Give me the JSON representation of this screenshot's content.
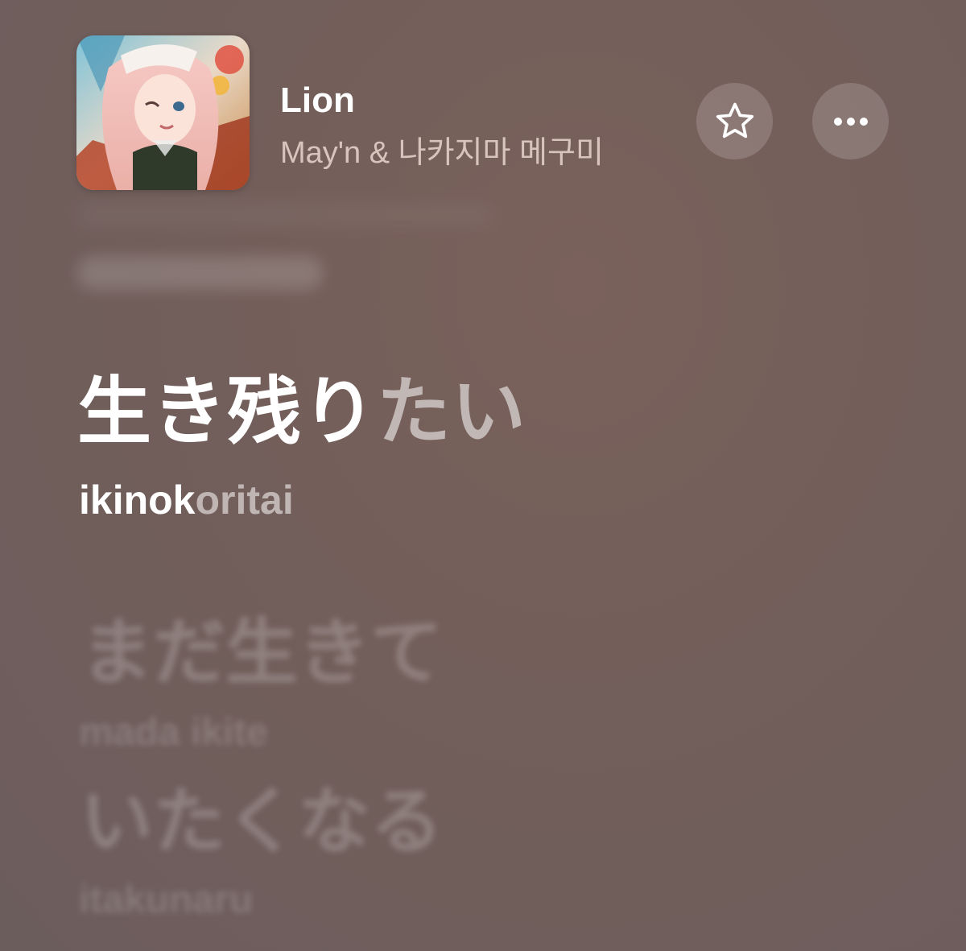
{
  "now_playing": {
    "title": "Lion",
    "artist": "May'n & 나카지마 메구미",
    "artwork_icon": "album-artwork"
  },
  "actions": {
    "favorite_icon": "star-outline-icon",
    "more_icon": "ellipsis-icon"
  },
  "lyrics": {
    "current": {
      "text_sung": "生き残り",
      "text_unsung": "たい",
      "roman_sung": "ikinok",
      "roman_unsung": "oritai"
    },
    "upcoming": [
      {
        "text": "まだ生きて",
        "roman": "mada  ikite"
      },
      {
        "text": "いたくなる",
        "roman": "itakunaru"
      }
    ]
  },
  "colors": {
    "background": "#725e5a",
    "artist_text": "#d8c4bd",
    "active_lyric": "#ffffff"
  }
}
